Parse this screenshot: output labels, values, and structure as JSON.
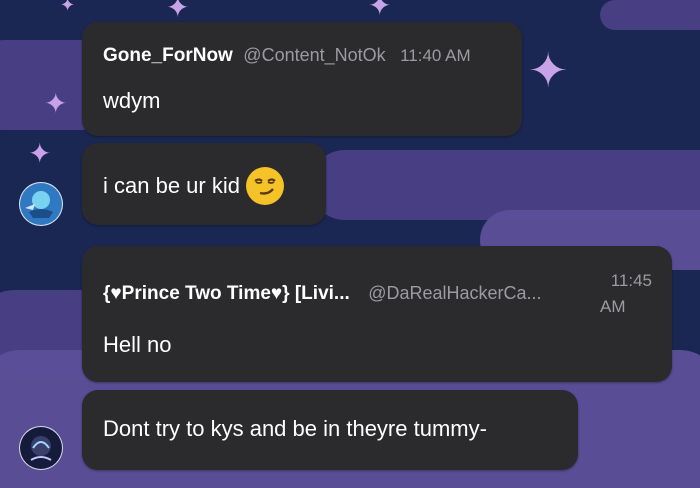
{
  "messages": [
    {
      "author": "Gone_ForNow",
      "handle": "@Content_NotOk",
      "time": "11:40 AM",
      "lines": [
        "wdym",
        "i can be ur kid"
      ]
    },
    {
      "author": "{♥Prince Two Time♥} [Livi...",
      "handle": "@DaRealHackerCa...",
      "time_line1": "11:45",
      "time_line2": "AM",
      "lines": [
        "Hell no",
        "Dont try to kys and be in theyre tummy-"
      ]
    }
  ],
  "emoji": "smirk-emoji",
  "colors": {
    "bubble": "#2b2b2d",
    "background": "#1a2752",
    "cloud": "#4a3f86",
    "star": "#c9a3e8"
  }
}
